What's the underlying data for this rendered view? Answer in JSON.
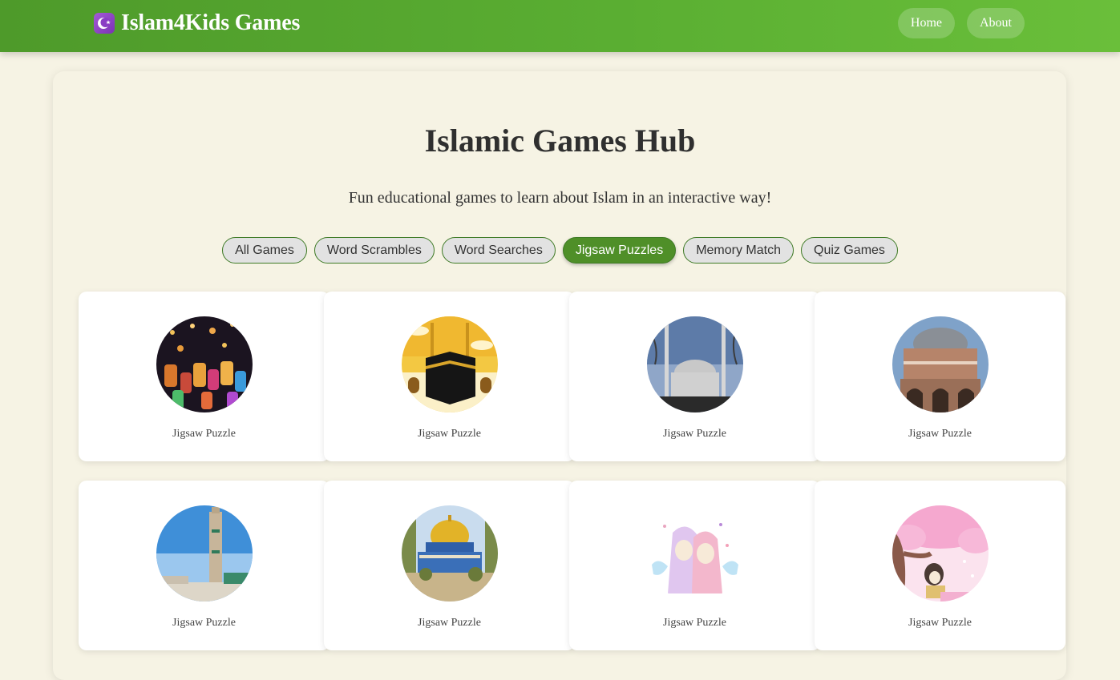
{
  "brand": {
    "icon": "crescent-star-icon",
    "title": "Islam4Kids Games"
  },
  "nav": {
    "links": [
      "Home",
      "About"
    ]
  },
  "hero": {
    "title": "Islamic Games Hub",
    "subtitle": "Fun educational games to learn about Islam in an interactive way!"
  },
  "filters": {
    "items": [
      "All Games",
      "Word Scrambles",
      "Word Searches",
      "Jigsaw Puzzles",
      "Memory Match",
      "Quiz Games"
    ],
    "active": "Jigsaw Puzzles"
  },
  "games": [
    {
      "label": "Jigsaw Puzzle",
      "image": "lanterns-image"
    },
    {
      "label": "Jigsaw Puzzle",
      "image": "kaaba-image"
    },
    {
      "label": "Jigsaw Puzzle",
      "image": "mosque-minarets-image"
    },
    {
      "label": "Jigsaw Puzzle",
      "image": "ottoman-mosque-image"
    },
    {
      "label": "Jigsaw Puzzle",
      "image": "hassan-minaret-image"
    },
    {
      "label": "Jigsaw Puzzle",
      "image": "dome-of-rock-image"
    },
    {
      "label": "Jigsaw Puzzle",
      "image": "hijabi-girls-image"
    },
    {
      "label": "Jigsaw Puzzle",
      "image": "girl-under-tree-image"
    }
  ],
  "colors": {
    "nav_green": "#5aae32",
    "accent_green": "#4f8f28",
    "background": "#f6f3e4"
  }
}
